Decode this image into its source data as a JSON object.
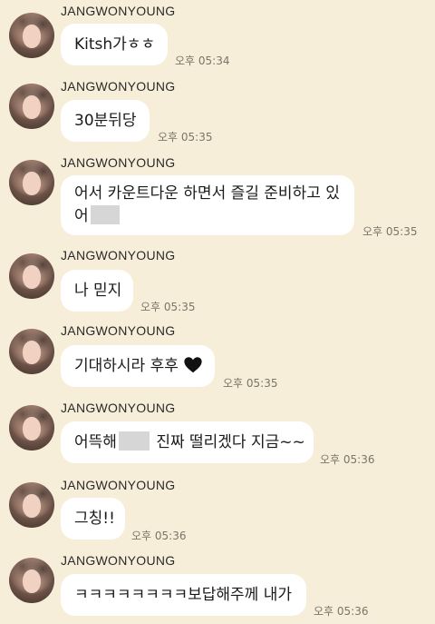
{
  "messages": [
    {
      "sender": "JANGWONYOUNG",
      "text": "Kitsh가ㅎㅎ",
      "time": "오후 05:34"
    },
    {
      "sender": "JANGWONYOUNG",
      "text": "30분뒤당",
      "time": "오후 05:35"
    },
    {
      "sender": "JANGWONYOUNG",
      "line1": "어서 카운트다운 하면서 즐길 준비하고 있",
      "line2": "어",
      "time": "오후 05:35"
    },
    {
      "sender": "JANGWONYOUNG",
      "text": "나 믿지",
      "time": "오후 05:35"
    },
    {
      "sender": "JANGWONYOUNG",
      "text": "기대하시라 후후",
      "emoji": "black-heart",
      "time": "오후 05:35"
    },
    {
      "sender": "JANGWONYOUNG",
      "text_before": "어뜩해",
      "text_after": " 진짜 떨리겠다 지금~~",
      "time": "오후 05:36"
    },
    {
      "sender": "JANGWONYOUNG",
      "text": "그칭!!",
      "time": "오후 05:36"
    },
    {
      "sender": "JANGWONYOUNG",
      "text": "ㅋㅋㅋㅋㅋㅋㅋㅋ보답해주께 내가",
      "time": "오후 05:36"
    }
  ],
  "colors": {
    "background": "#f7eed9",
    "bubble": "#ffffff",
    "time": "#7a7568"
  }
}
